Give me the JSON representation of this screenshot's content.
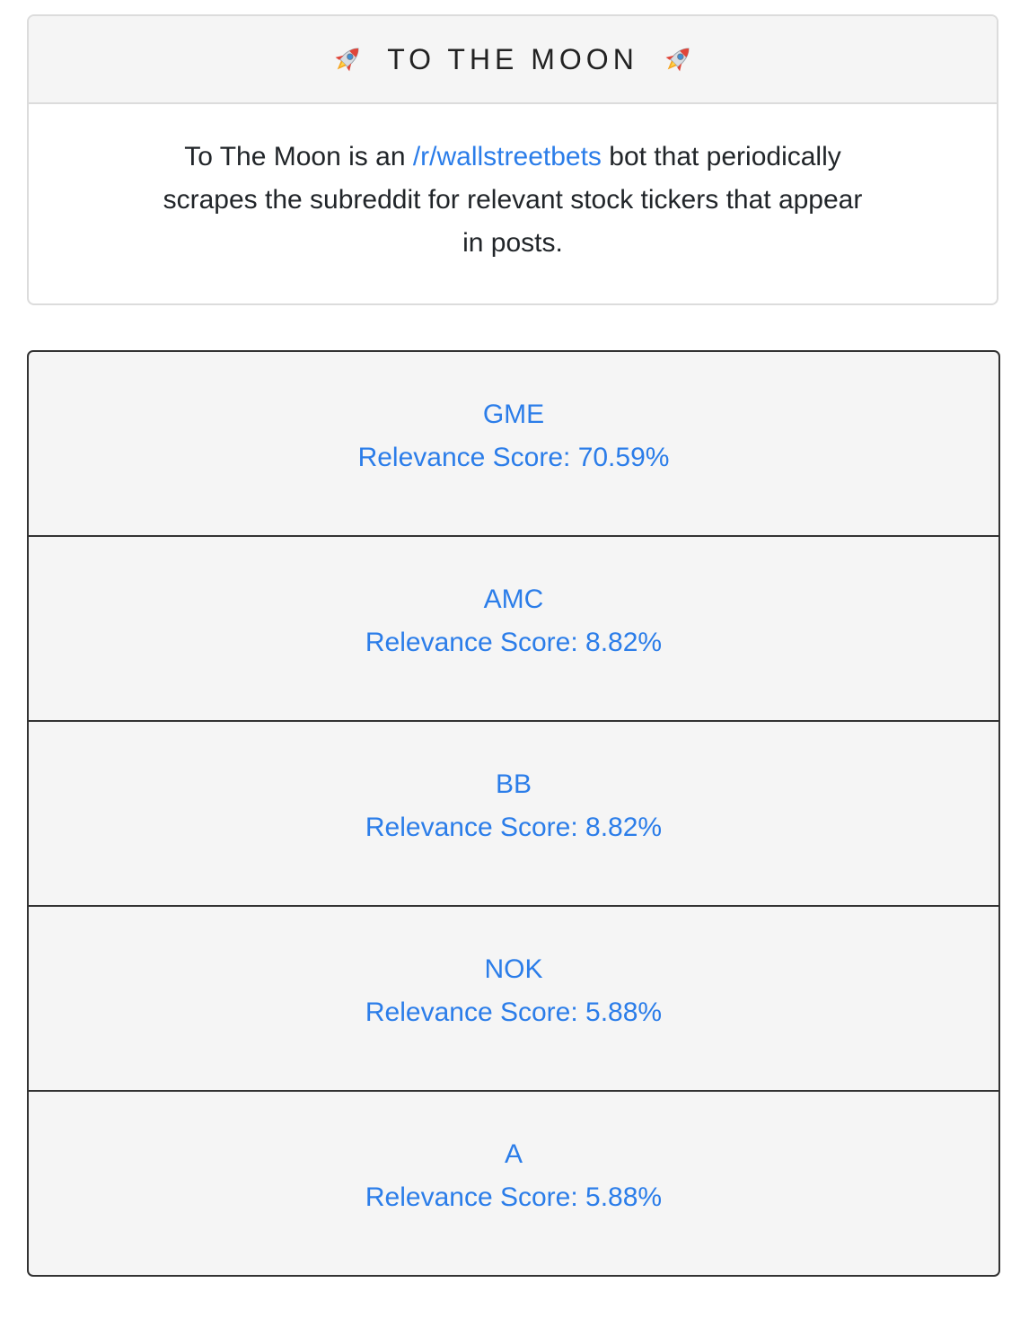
{
  "header": {
    "title": "TO THE MOON",
    "icon_left": "rocket-icon",
    "icon_right": "rocket-icon"
  },
  "intro": {
    "text_before": "To The Moon is an ",
    "link_text": "/r/wallstreetbets",
    "text_after": " bot that periodically scrapes the subreddit for relevant stock tickers that appear in posts."
  },
  "tickers": [
    {
      "symbol": "GME",
      "score": "Relevance Score: 70.59%"
    },
    {
      "symbol": "AMC",
      "score": "Relevance Score: 8.82%"
    },
    {
      "symbol": "BB",
      "score": "Relevance Score: 8.82%"
    },
    {
      "symbol": "NOK",
      "score": "Relevance Score: 5.88%"
    },
    {
      "symbol": "A",
      "score": "Relevance Score: 5.88%"
    }
  ],
  "colors": {
    "link": "#2b7de9",
    "panel_bg": "#f5f5f5",
    "border_dark": "#333333",
    "border_light": "#dcdcdc"
  }
}
